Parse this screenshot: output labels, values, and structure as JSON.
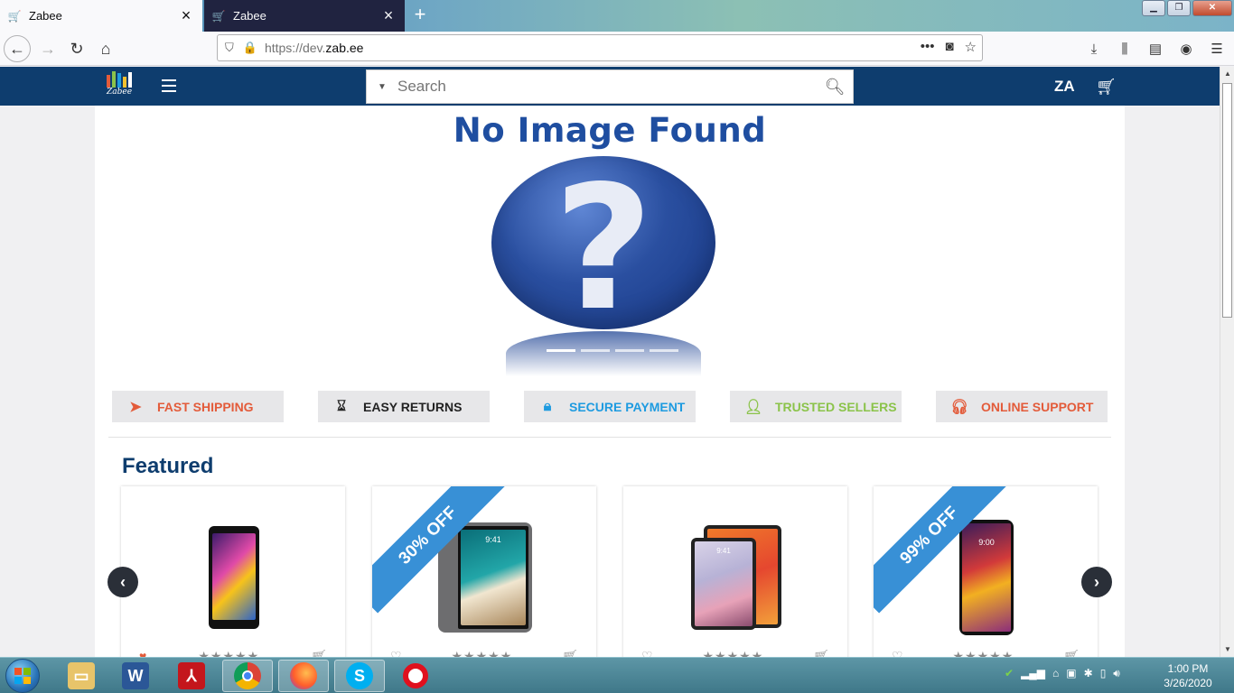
{
  "browser": {
    "tabs": [
      {
        "title": "Zabee",
        "active": true
      },
      {
        "title": "Zabee",
        "active": false
      }
    ],
    "url": {
      "scheme": "https://dev.",
      "host": "zab.ee"
    }
  },
  "site": {
    "logo_text": "Zabee",
    "search": {
      "placeholder": "Search"
    },
    "region": "ZA"
  },
  "hero": {
    "title": "No Image Found",
    "question": "?"
  },
  "features": [
    {
      "label": "FAST SHIPPING",
      "color": "#e35b3a",
      "icon": "paper-plane-icon"
    },
    {
      "label": "EASY RETURNS",
      "color": "#222222",
      "icon": "hourglass-icon"
    },
    {
      "label": "SECURE PAYMENT",
      "color": "#1e9be0",
      "icon": "lock-icon"
    },
    {
      "label": "TRUSTED SELLERS",
      "color": "#8bc34a",
      "icon": "user-icon"
    },
    {
      "label": "ONLINE SUPPORT",
      "color": "#e35b3a",
      "icon": "headset-icon"
    }
  ],
  "featured": {
    "heading": "Featured",
    "products": [
      {
        "badge": "",
        "favorited": true,
        "rating": "★★★★★",
        "time": ""
      },
      {
        "badge": "30% OFF",
        "favorited": false,
        "rating": "★★★★★",
        "time": "9:41"
      },
      {
        "badge": "",
        "favorited": false,
        "rating": "★★★★★",
        "time": "9:41"
      },
      {
        "badge": "99% OFF",
        "favorited": false,
        "rating": "★★★★★",
        "time": "9:00"
      }
    ]
  },
  "taskbar": {
    "clock_time": "1:00 PM",
    "clock_date": "3/26/2020"
  }
}
